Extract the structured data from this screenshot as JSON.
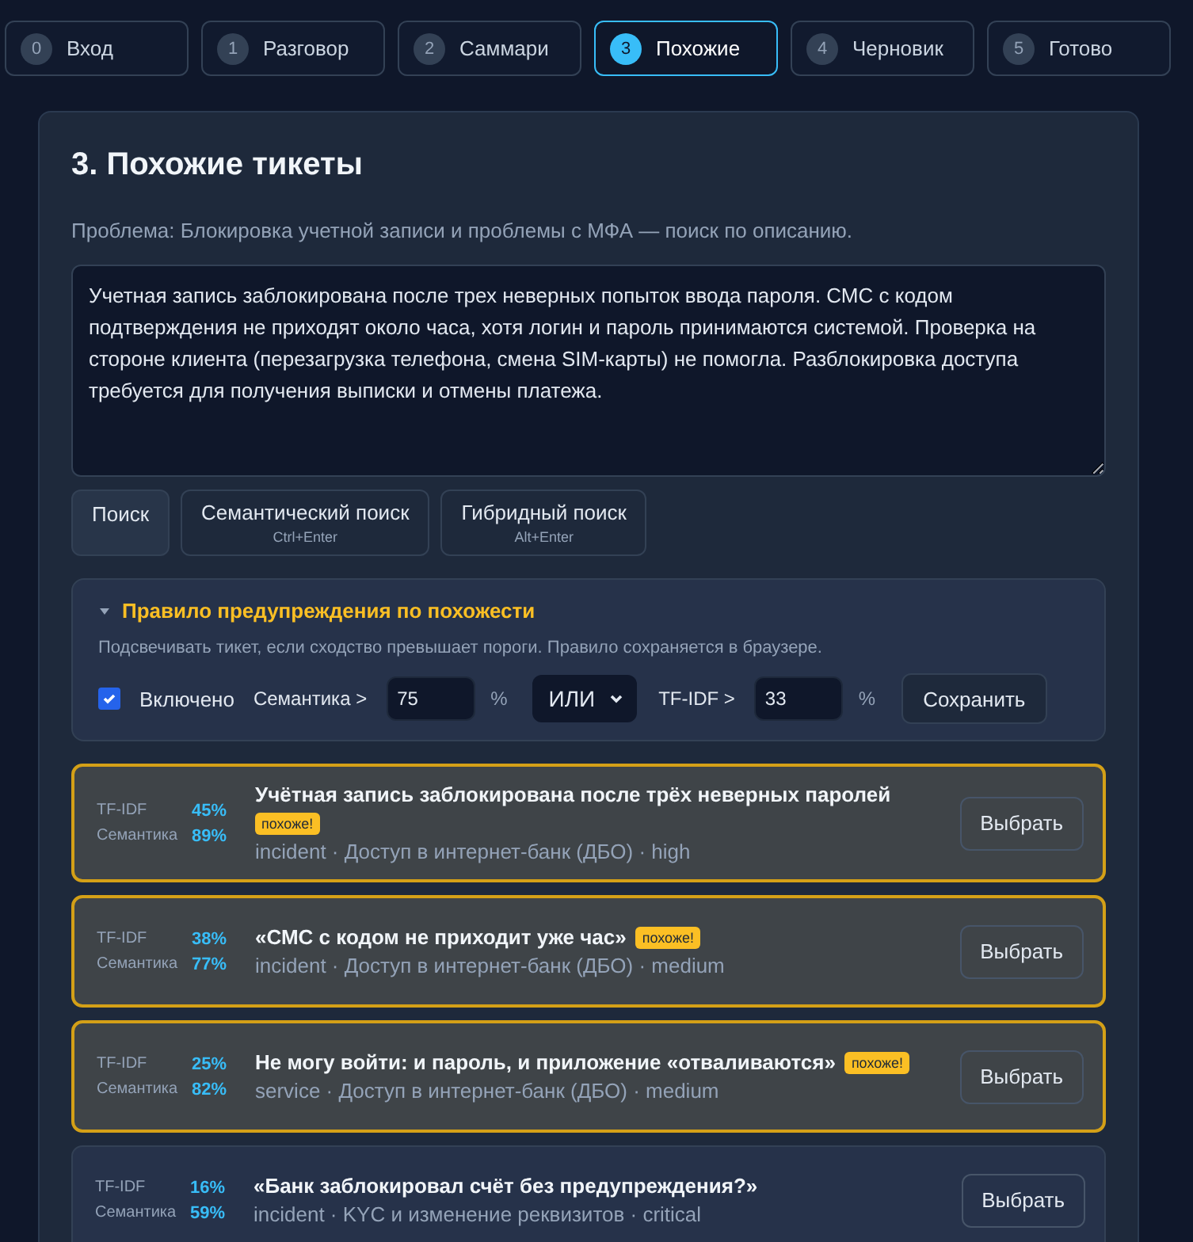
{
  "steps": [
    {
      "number": "0",
      "label": "Вход",
      "selected": false
    },
    {
      "number": "1",
      "label": "Разговор",
      "selected": false
    },
    {
      "number": "2",
      "label": "Саммари",
      "selected": false
    },
    {
      "number": "3",
      "label": "Похожие",
      "selected": true
    },
    {
      "number": "4",
      "label": "Черновик",
      "selected": false
    },
    {
      "number": "5",
      "label": "Готово",
      "selected": false
    }
  ],
  "title": "3. Похожие тикеты",
  "problem": "Проблема: Блокировка учетной записи и проблемы с МФА — поиск по описанию.",
  "query": "Учетная запись заблокирована после трех неверных попыток ввода пароля. СМС с кодом подтверждения не приходят около часа, хотя логин и пароль принимаются системой. Проверка на стороне клиента (перезагрузка телефона, смена SIM-карты) не помогла. Разблокировка доступа требуется для получения выписки и отмены платежа.",
  "search_buttons": [
    {
      "label": "Поиск",
      "selected": true
    },
    {
      "label": "Семантический поиск",
      "shortcut": "Ctrl+Enter",
      "selected": false
    },
    {
      "label": "Гибридный поиск",
      "shortcut": "Alt+Enter",
      "selected": false
    }
  ],
  "rule": {
    "expanded": true,
    "title": "Правило предупреждения по похожести",
    "hint": "Подсвечивать тикет, если сходство превышает пороги. Правило сохраняется в браузере.",
    "enabled": true,
    "enabled_label": "Включено",
    "semantic_label": "Семантика >",
    "semantic_value": "75",
    "percent_1": "%",
    "operator": "ИЛИ",
    "tfidf_label": "TF-IDF >",
    "tfidf_value": "33",
    "percent_2": "%",
    "save": "Сохранить"
  },
  "results": [
    {
      "tfidf_label": "TF-IDF",
      "tfidf": "45%",
      "semantic_label": "Семантика",
      "semantic": "89%",
      "title": "Учётная запись заблокирована после трёх неверных паролей",
      "flagged": true,
      "badge": "похоже!",
      "meta": "incident · Доступ в интернет-банк (ДБО) · high",
      "action": "Выбрать"
    },
    {
      "tfidf_label": "TF-IDF",
      "tfidf": "38%",
      "semantic_label": "Семантика",
      "semantic": "77%",
      "title": "«СМС с кодом не приходит уже час»",
      "flagged": true,
      "badge": "похоже!",
      "meta": "incident · Доступ в интернет-банк (ДБО) · medium",
      "action": "Выбрать"
    },
    {
      "tfidf_label": "TF-IDF",
      "tfidf": "25%",
      "semantic_label": "Семантика",
      "semantic": "82%",
      "title": "Не могу войти: и пароль, и приложение «отваливаются»",
      "flagged": true,
      "badge": "похоже!",
      "meta": "service · Доступ в интернет-банк (ДБО) · medium",
      "action": "Выбрать"
    },
    {
      "tfidf_label": "TF-IDF",
      "tfidf": "16%",
      "semantic_label": "Семантика",
      "semantic": "59%",
      "title": "«Банк заблокировал счёт без предупреждения?»",
      "flagged": false,
      "meta": "incident · KYC и изменение реквизитов · critical",
      "action": "Выбрать"
    }
  ]
}
